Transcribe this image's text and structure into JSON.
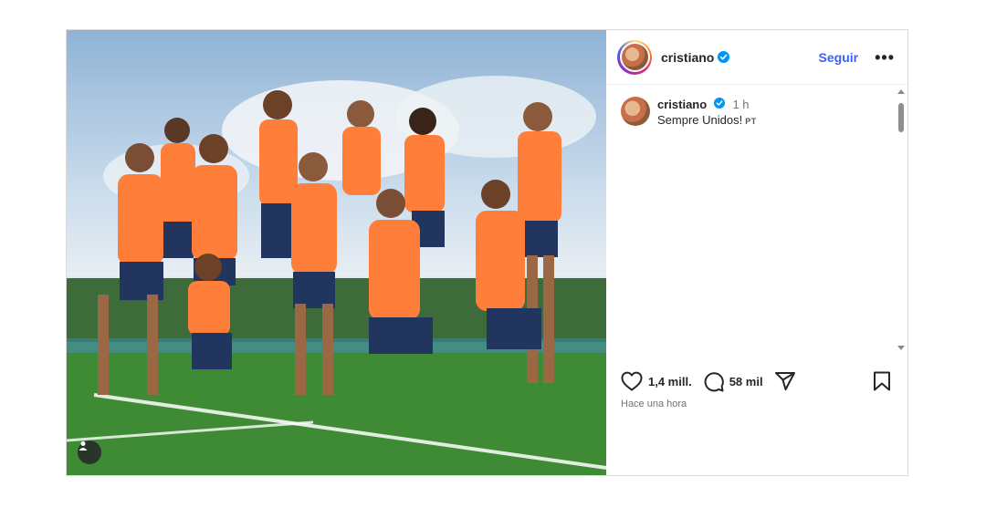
{
  "photo": {
    "description_icon": "person-tag-icon"
  },
  "header": {
    "username": "cristiano",
    "follow_label": "Seguir",
    "more_label": "•••",
    "verified_color": "#0095f6"
  },
  "caption": {
    "username": "cristiano",
    "time": "1 h",
    "text": "Sempre Unidos!",
    "lang": "PT"
  },
  "actions": {
    "likes": "1,4 mill.",
    "comments": "58 mil"
  },
  "timeago": "Hace una hora"
}
